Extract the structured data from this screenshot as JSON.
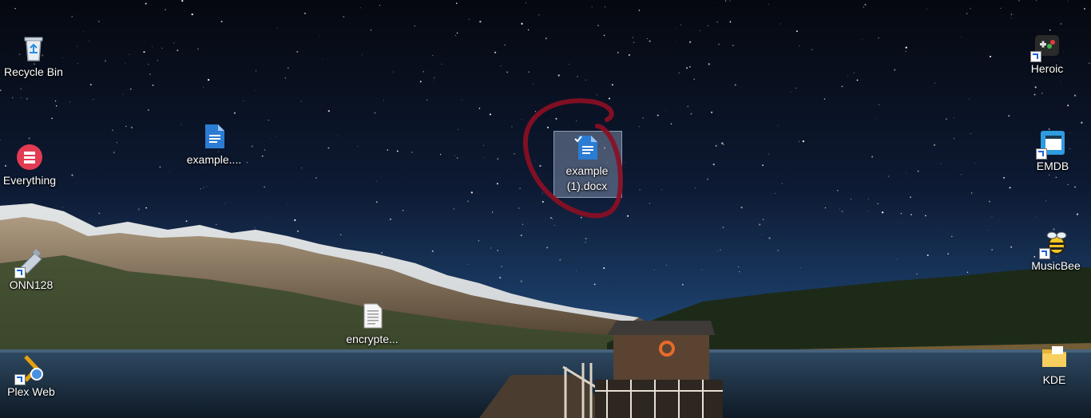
{
  "desktop": {
    "icons": [
      {
        "id": "recycle-bin",
        "label": "Recycle Bin",
        "icon": "recycle-bin-icon"
      },
      {
        "id": "everything",
        "label": "Everything",
        "icon": "everything-search-icon"
      },
      {
        "id": "onn128",
        "label": "ONN128",
        "icon": "usb-drive-icon"
      },
      {
        "id": "plex-web",
        "label": "Plex Web",
        "icon": "chrome-app-icon"
      },
      {
        "id": "example-doc",
        "label": "example....",
        "icon": "word-document-icon"
      },
      {
        "id": "example-1-docx",
        "label": "example (1).docx",
        "icon": "word-document-icon"
      },
      {
        "id": "encrypted",
        "label": "encrypte...",
        "icon": "text-file-icon"
      },
      {
        "id": "heroic",
        "label": "Heroic",
        "icon": "gamepad-icon"
      },
      {
        "id": "emdb",
        "label": "EMDB",
        "icon": "film-clapper-icon"
      },
      {
        "id": "musicbee",
        "label": "MusicBee",
        "icon": "bee-icon"
      },
      {
        "id": "kde",
        "label": "KDE",
        "icon": "folder-icon"
      }
    ],
    "annotation": {
      "type": "hand-drawn-circle",
      "color": "#8b0f24"
    },
    "wallpaper": "night-lake-mountains"
  }
}
